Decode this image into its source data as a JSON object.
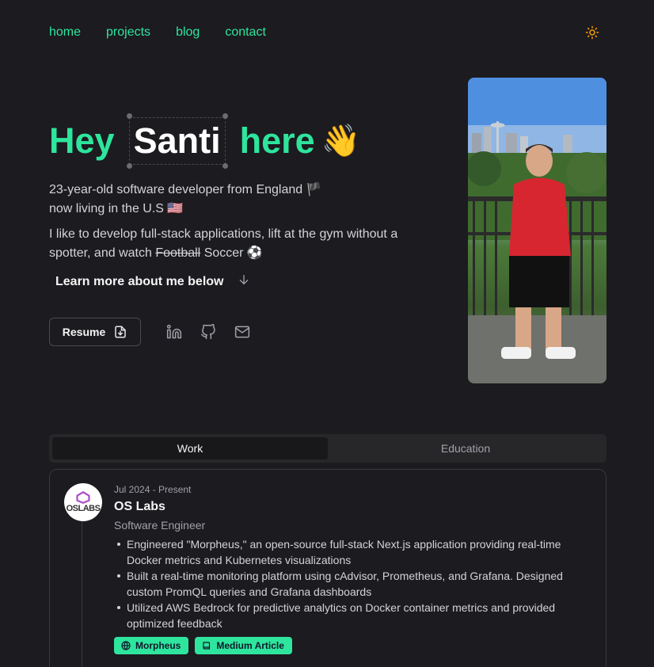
{
  "nav": {
    "items": [
      "home",
      "projects",
      "blog",
      "contact"
    ]
  },
  "hero": {
    "hey": "Hey",
    "name": "Santi",
    "here": "here",
    "wave": "👋",
    "line1": "23-year-old software developer from England 🏴",
    "line2": "now living in the U.S 🇺🇸",
    "bio_a": "I like to develop full-stack applications, lift at the gym without a spotter, and watch",
    "bio_strike": "Football",
    "bio_b": "Soccer ⚽",
    "learn_more": "Learn more about me below",
    "resume": "Resume"
  },
  "icons": {
    "theme": "sun-icon",
    "linkedin": "linkedin-icon",
    "github": "github-icon",
    "mail": "mail-icon",
    "download": "file-download-icon",
    "arrow": "arrow-down-icon"
  },
  "tabs": {
    "work": "Work",
    "education": "Education",
    "active": "Work"
  },
  "experience": {
    "logo": "OSLABS",
    "date": "Jul 2024 - Present",
    "company": "OS Labs",
    "role": "Software Engineer",
    "bullets": [
      "Engineered \"Morpheus,\" an open-source full-stack Next.js application providing real-time Docker metrics and Kubernetes visualizations",
      "Built a real-time monitoring platform using cAdvisor, Prometheus, and Grafana. Designed custom PromQL queries and Grafana dashboards",
      "Utilized AWS Bedrock for predictive analytics on Docker container metrics and provided optimized feedback"
    ],
    "badges": [
      "Morpheus",
      "Medium Article"
    ]
  },
  "colors": {
    "accent": "#2ee59d",
    "background": "#1c1b1f"
  }
}
